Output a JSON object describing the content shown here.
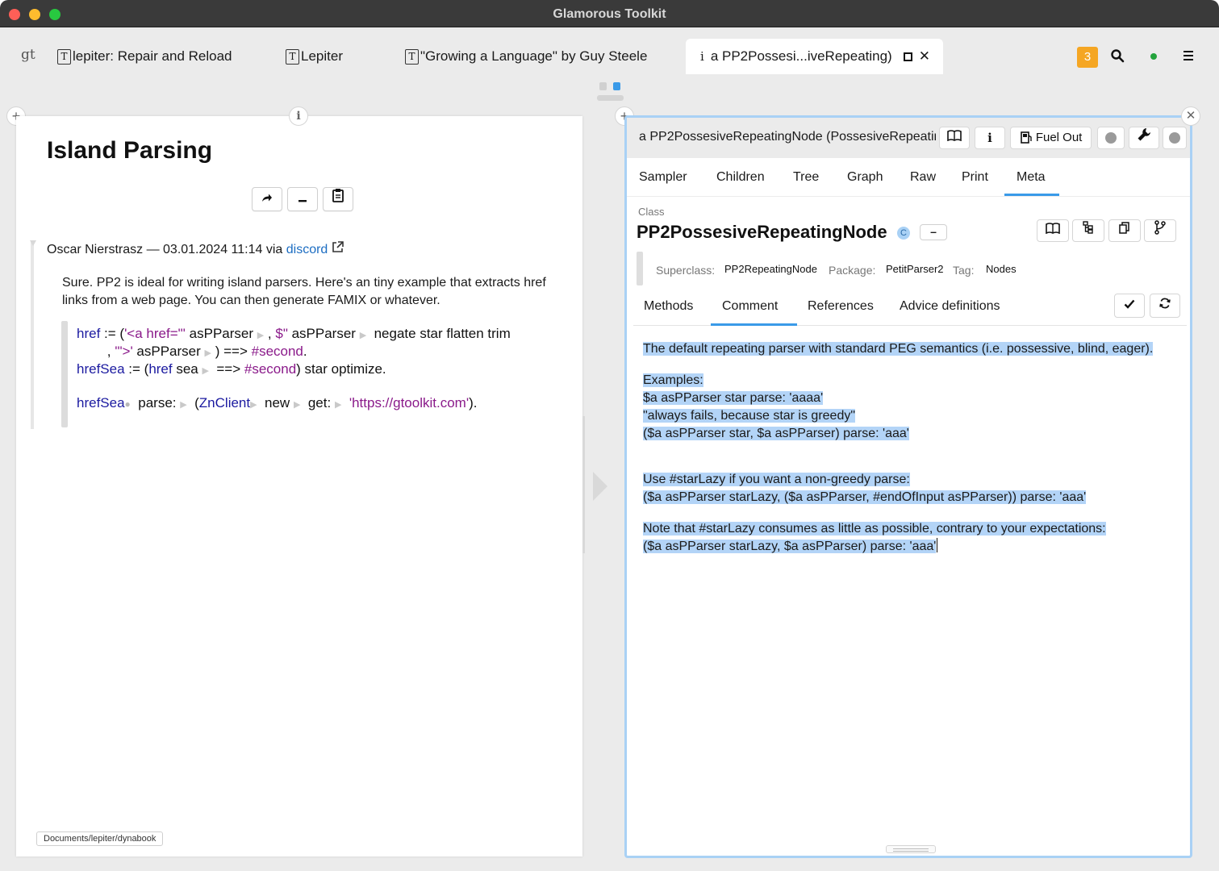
{
  "window": {
    "title": "Glamorous Toolkit"
  },
  "tabbar": {
    "logo": "gt",
    "tabs": [
      {
        "label": "lepiter: Repair and Reload"
      },
      {
        "label": "Lepiter"
      },
      {
        "label": "\"Growing a Language\" by Guy Steele"
      },
      {
        "label": "a PP2Possesi...iveRepeating)"
      }
    ],
    "notification_count": "3"
  },
  "left_page": {
    "title": "Island Parsing",
    "author": "Oscar Nierstrasz — 03.01.2024 11:14 via",
    "source_link": "discord",
    "message": "Sure. PP2 is ideal for writing island parsers. Here's an tiny example that extracts href links from a web page. You can then generate FAMIX or whatever.",
    "code": {
      "l1_var": "href",
      "l1_op": " := (",
      "l1_str1": "'<a href=\"'",
      "l1_a": " asPParser ",
      "l1_b": " , ",
      "l1_str2": "$\"",
      "l1_c": " asPParser ",
      "l1_d": "  negate star flatten trim",
      "l2_a": "        , ",
      "l2_str": "'\">'",
      "l2_b": " asPParser ",
      "l2_c": " ) ==> ",
      "l2_sym": "#second",
      "l2_d": ".",
      "l3_var": "hrefSea",
      "l3_a": " := (",
      "l3_var2": "href",
      "l3_b": " sea ",
      "l3_c": "  ==> ",
      "l3_sym": "#second",
      "l3_d": ") star optimize.",
      "l4_var": "hrefSea",
      "l4_a": "  parse: ",
      "l4_b": "  (",
      "l4_cls": "ZnClient",
      "l4_c": "  new ",
      "l4_d": "  get: ",
      "l4_str": "  'https://gtoolkit.com'",
      "l4_e": ")."
    },
    "path": "Documents/lepiter/dynabook"
  },
  "inspector": {
    "title": "a PP2PossesiveRepeatingNode (PossesiveRepeatin",
    "fuel_out": "Fuel Out",
    "view_tabs": [
      "Sampler",
      "Children",
      "Tree",
      "Graph",
      "Raw",
      "Print",
      "Meta"
    ],
    "class_label": "Class",
    "class_name": "PP2PossesiveRepeatingNode",
    "class_badge": "C",
    "superclass_label": "Superclass:",
    "superclass": "PP2RepeatingNode",
    "package_label": "Package:",
    "package": "PetitParser2",
    "tag_label": "Tag:",
    "tag": "Nodes",
    "sub_tabs": [
      "Methods",
      "Comment",
      "References",
      "Advice definitions"
    ],
    "comment": {
      "p1": "The default repeating parser with standard PEG semantics (i.e. possessive, blind, eager).",
      "p2_1": "Examples:",
      "p2_2": "$a asPParser star parse: 'aaaa'",
      "p2_3": "\"always fails, because star is greedy\"",
      "p2_4": "($a asPParser star, $a asPParser) parse: 'aaa'",
      "p3_1": "Use #starLazy if you want a non-greedy parse:",
      "p3_2": "($a asPParser starLazy, ($a asPParser, #endOfInput asPParser)) parse: 'aaa'",
      "p4_1": "Note that #starLazy consumes as little as possible, contrary to your expectations:",
      "p4_2": "($a asPParser starLazy, $a asPParser) parse: 'aaa'"
    }
  }
}
